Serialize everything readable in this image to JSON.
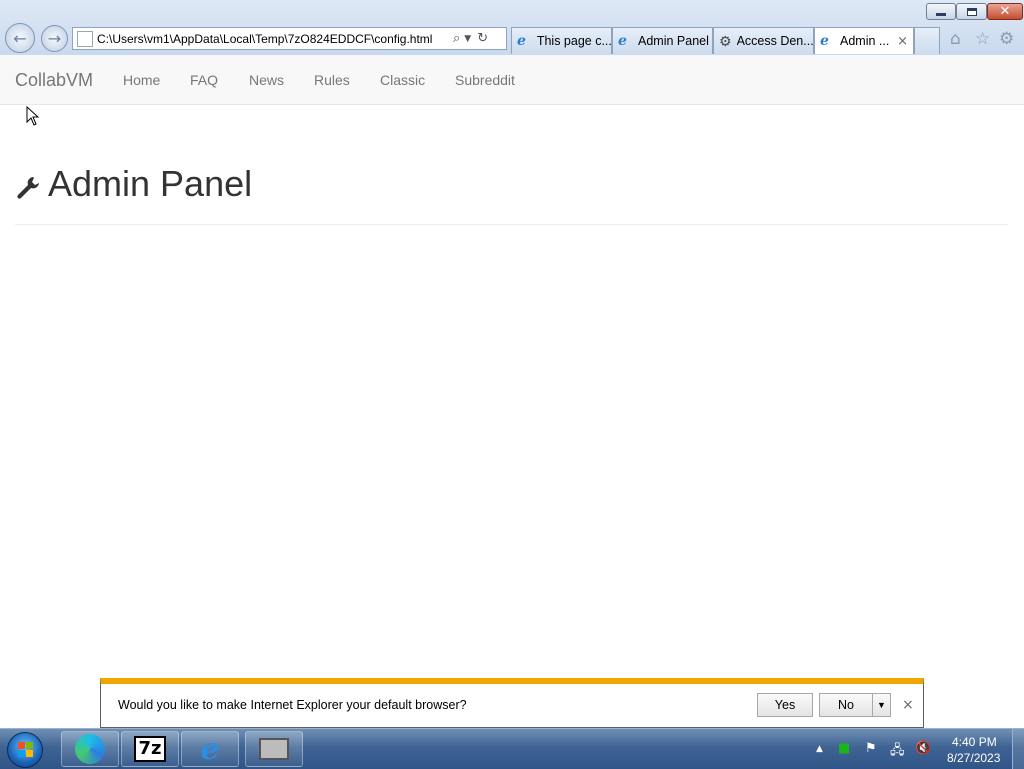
{
  "browser": {
    "address": "C:\\Users\\vm1\\AppData\\Local\\Temp\\7zO824EDDCF\\config.html",
    "tabs": [
      {
        "label": "This page c...",
        "icon": "ie-icon",
        "active": false
      },
      {
        "label": "Admin Panel",
        "icon": "ie-icon",
        "active": false
      },
      {
        "label": "Access Den...",
        "icon": "gear-icon",
        "active": false
      },
      {
        "label": "Admin ...",
        "icon": "ie-icon",
        "active": true
      }
    ],
    "tab_close": "×"
  },
  "page": {
    "brand": "CollabVM",
    "nav": [
      "Home",
      "FAQ",
      "News",
      "Rules",
      "Classic",
      "Subreddit"
    ],
    "title": "Admin Panel"
  },
  "notification": {
    "message": "Would you like to make Internet Explorer your default browser?",
    "yes": "Yes",
    "no": "No",
    "close": "×",
    "accent_color": "#f0a800"
  },
  "taskbar": {
    "sevenzip_label": "7z",
    "time": "4:40 PM",
    "date": "8/27/2023"
  }
}
